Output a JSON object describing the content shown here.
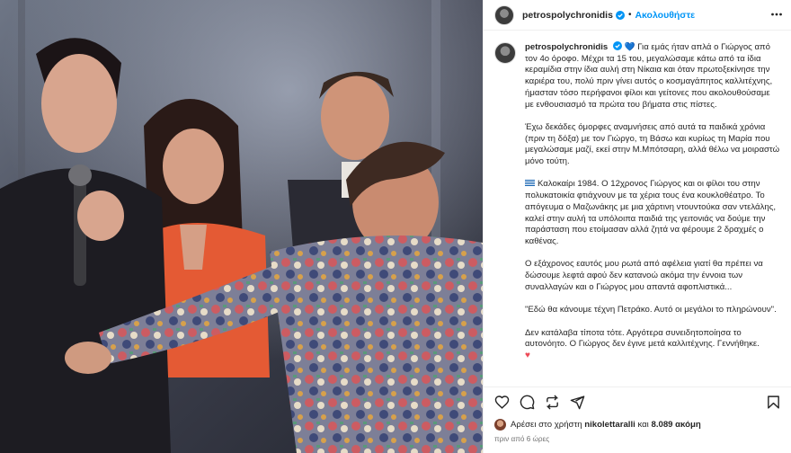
{
  "header": {
    "username": "petrospolychronidis",
    "separator": "•",
    "follow_label": "Ακολουθήστε"
  },
  "caption": {
    "username": "petrospolychronidis",
    "heart_emoji": "💙",
    "paragraphs": [
      "Για εμάς ήταν απλά ο Γιώργος από τον 4ο όροφο. Μέχρι τα 15 του, μεγαλώσαμε κάτω από τα ίδια κεραμίδια στην ίδια αυλή στη Νίκαια και όταν πρωτοξεκίνησε την καριέρα του, πολύ πριν γίνει αυτός ο κοσμαγάπητος καλλιτέχνης, ήμασταν τόσο περήφανοι φίλοι και γείτονες που ακολουθούσαμε με ενθουσιασμό τα πρώτα του βήματα στις πίστες.",
      "Έχω δεκάδες όμορφες αναμνήσεις από αυτά τα παιδικά χρόνια (πριν τη δόξα) με τον Γιώργο, τη Βάσω και κυρίως τη Μαρία που μεγαλώσαμε μαζί, εκεί στην Μ.Μπότσαρη, αλλά θέλω να μοιραστώ μόνο τούτη.",
      "Καλοκαίρι 1984. Ο 12χρονος Γιώργος και οι φίλοι του στην πολυκατοικία φτιάχνουν με τα χέρια τους ένα κουκλοθέατρο. Το απόγευμα ο Μαζωνάκης με μια χάρτινη ντουντούκα σαν ντελάλης, καλεί στην αυλή τα υπόλοιπα παιδιά της γειτονιάς να δούμε την παράσταση που ετοίμασαν αλλά ζητά να φέρουμε 2 δραχμές ο καθένας.",
      "Ο εξάχρονος εαυτός μου ρωτά από αφέλεια γιατί θα πρέπει να δώσουμε λεφτά αφού δεν κατανοώ ακόμα την έννοια των συναλλαγών και ο Γιώργος μου απαντά αφοπλιστικά...",
      "\"Εδώ θα κάνουμε τέχνη Πετράκο. Αυτό οι μεγάλοι το πληρώνουν\".",
      "Δεν κατάλαβα τίποτα τότε. Αργότερα συνειδητοποίησα το αυτονόητο. Ο Γιώργος δεν έγινε μετά καλλιτέχνης. Γεννήθηκε."
    ],
    "end_emoji": "♥"
  },
  "likes": {
    "prefix": "Αρέσει στο χρήστη",
    "user": "nikolettaralli",
    "and": "και",
    "count": "8.089 ακόμη"
  },
  "timestamp": "πριν από 6 ώρες",
  "colors": {
    "accent": "#0095f6",
    "verified": "#0095f6",
    "heart": "#ed4956",
    "muted": "#737373"
  },
  "icons": {
    "like": "heart-icon",
    "comment": "comment-icon",
    "repost": "repost-icon",
    "share": "share-icon",
    "save": "bookmark-icon",
    "more": "more-icon"
  }
}
